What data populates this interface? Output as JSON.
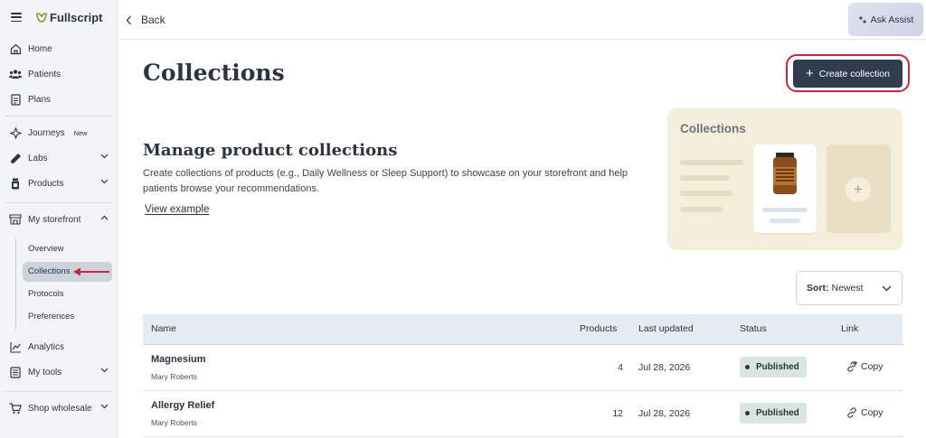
{
  "brand": {
    "name": "Fullscript"
  },
  "sidebar": {
    "items": [
      {
        "label": "Home",
        "icon": "home-icon"
      },
      {
        "label": "Patients",
        "icon": "patients-icon"
      },
      {
        "label": "Plans",
        "icon": "plans-icon"
      },
      {
        "label": "Journeys",
        "icon": "journeys-icon",
        "badge": "New"
      },
      {
        "label": "Labs",
        "icon": "labs-icon"
      },
      {
        "label": "Products",
        "icon": "products-icon"
      },
      {
        "label": "My storefront",
        "icon": "storefront-icon"
      },
      {
        "label": "Analytics",
        "icon": "analytics-icon"
      },
      {
        "label": "My tools",
        "icon": "tools-icon"
      },
      {
        "label": "Shop wholesale",
        "icon": "cart-icon"
      }
    ],
    "storefront_sub": [
      {
        "label": "Overview"
      },
      {
        "label": "Collections",
        "active": true
      },
      {
        "label": "Protocols"
      },
      {
        "label": "Preferences"
      }
    ]
  },
  "topbar": {
    "back_label": "Back",
    "assist_label": "Ask Assist"
  },
  "main": {
    "title": "Collections",
    "create_label": "Create collection",
    "section_title": "Manage product collections",
    "section_desc": "Create collections of products (e.g., Daily Wellness or Sleep Support) to showcase on your storefront and help patients browse your recommendations.",
    "view_example": "View example",
    "illustration_title": "Collections",
    "sort_prefix": "Sort:",
    "sort_value": "Newest"
  },
  "table": {
    "headers": {
      "name": "Name",
      "products": "Products",
      "last_updated": "Last updated",
      "status": "Status",
      "link": "Link"
    },
    "rows": [
      {
        "name": "Magnesium",
        "owner": "Mary Roberts",
        "products": "4",
        "last_updated": "Jul 28, 2026",
        "status": "Published",
        "link": "Copy"
      },
      {
        "name": "Allergy Relief",
        "owner": "Mary Roberts",
        "products": "12",
        "last_updated": "Jul 28, 2026",
        "status": "Published",
        "link": "Copy"
      }
    ]
  },
  "colors": {
    "primary": "#2f3d4e",
    "highlight": "#d6213f",
    "sidebar_bg": "#f3f4f5",
    "status_bg": "#d9e6df",
    "table_head_bg": "#e3ebf4"
  }
}
